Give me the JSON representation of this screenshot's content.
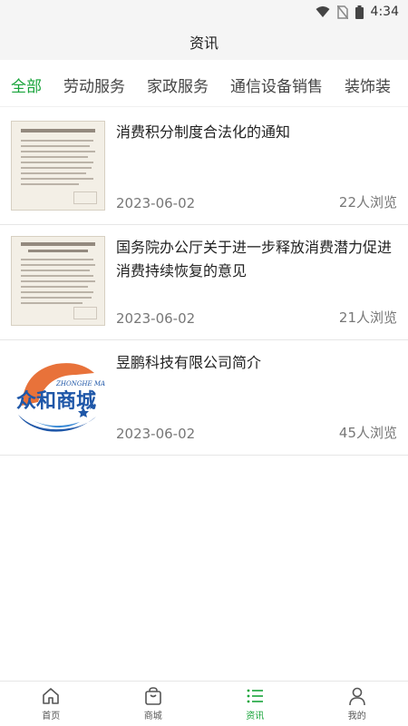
{
  "status_bar": {
    "time": "4:34"
  },
  "header": {
    "title": "资讯"
  },
  "tabs": [
    {
      "label": "全部",
      "active": true
    },
    {
      "label": "劳动服务",
      "active": false
    },
    {
      "label": "家政服务",
      "active": false
    },
    {
      "label": "通信设备销售",
      "active": false
    },
    {
      "label": "装饰装",
      "active": false
    }
  ],
  "articles": [
    {
      "title": "消费积分制度合法化的通知",
      "date": "2023-06-02",
      "views": "22人浏览",
      "thumb_icon": "document-thumbnail"
    },
    {
      "title": "国务院办公厅关于进一步释放消费潜力促进消费持续恢复的意见",
      "date": "2023-06-02",
      "views": "21人浏览",
      "thumb_icon": "document-thumbnail"
    },
    {
      "title": "昱鹏科技有限公司简介",
      "date": "2023-06-02",
      "views": "45人浏览",
      "thumb_icon": "zhonghe-mall-logo",
      "logo_text": "众和商城",
      "logo_subtext": "ZHONGHE MALL"
    }
  ],
  "bottom_nav": [
    {
      "label": "首页",
      "icon": "home-icon",
      "active": false
    },
    {
      "label": "商城",
      "icon": "shopping-bag-icon",
      "active": false
    },
    {
      "label": "资讯",
      "icon": "list-icon",
      "active": true
    },
    {
      "label": "我的",
      "icon": "user-icon",
      "active": false
    }
  ],
  "colors": {
    "accent": "#18a43a",
    "header_bg": "#f5f5f5"
  }
}
